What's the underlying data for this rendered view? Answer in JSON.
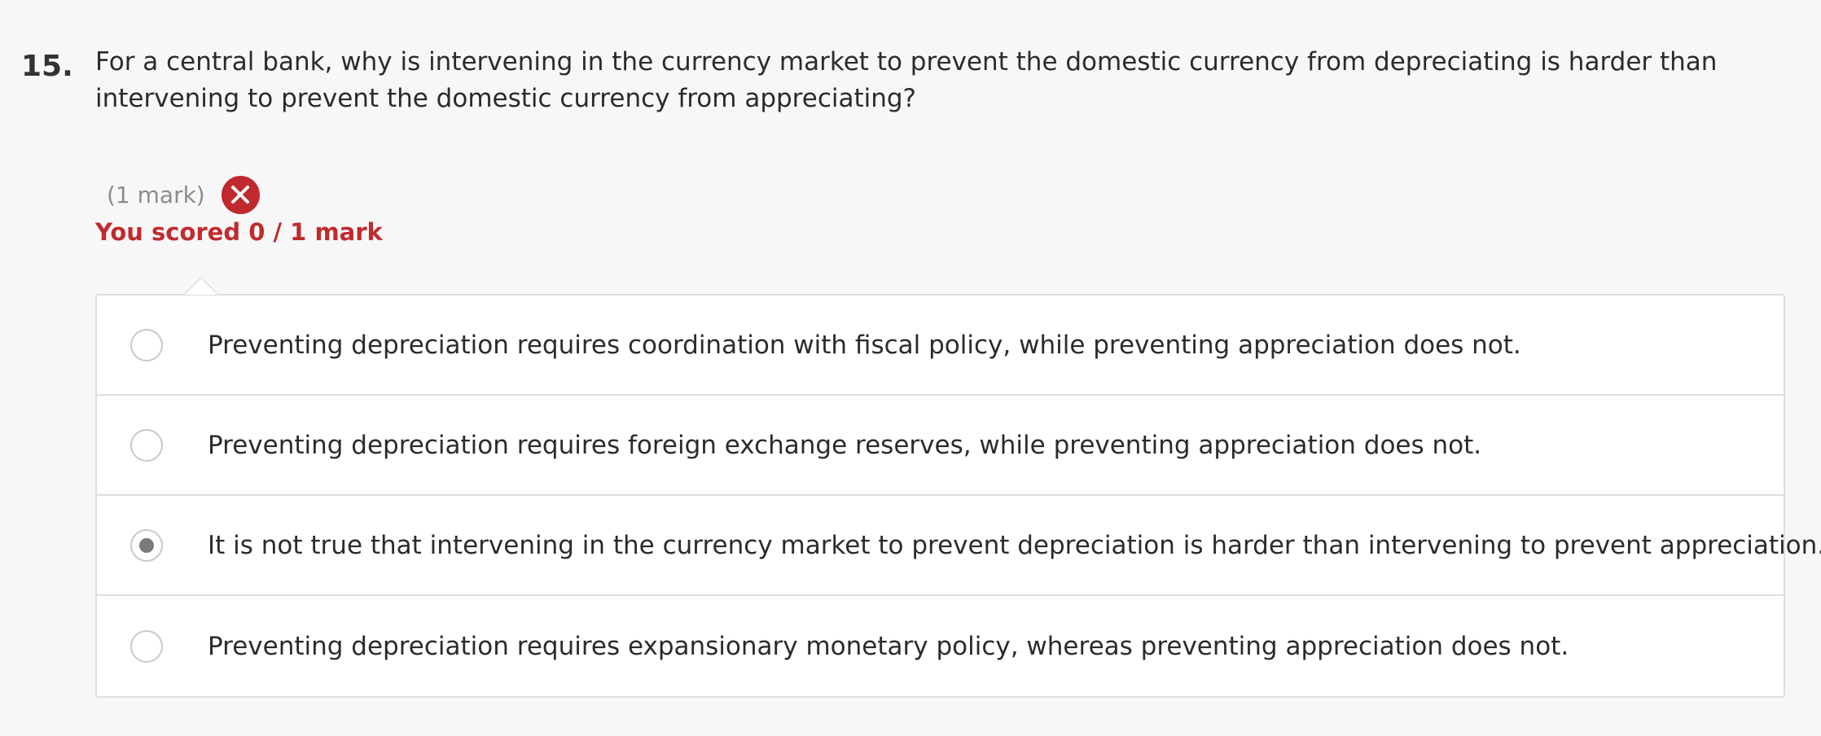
{
  "question": {
    "number": "15.",
    "text": "For a central bank, why is intervening in the currency market to prevent the domestic currency from depreciating is harder than intervening to prevent the domestic currency from appreciating?"
  },
  "marking": {
    "marks_label": "(1 mark)",
    "result_icon": "wrong-icon",
    "score_text": "You scored 0 / 1 mark",
    "score_color": "#bf2b2f"
  },
  "options": [
    {
      "text": "Preventing depreciation requires coordination with fiscal policy, while preventing appreciation does not.",
      "selected": false
    },
    {
      "text": "Preventing depreciation requires foreign exchange reserves, while preventing appreciation does not.",
      "selected": false
    },
    {
      "text": "It is not true that intervening in the currency market to prevent depreciation is harder than intervening to prevent appreciation.",
      "selected": true
    },
    {
      "text": "Preventing depreciation requires expansionary monetary policy, whereas preventing appreciation does not.",
      "selected": false
    }
  ]
}
